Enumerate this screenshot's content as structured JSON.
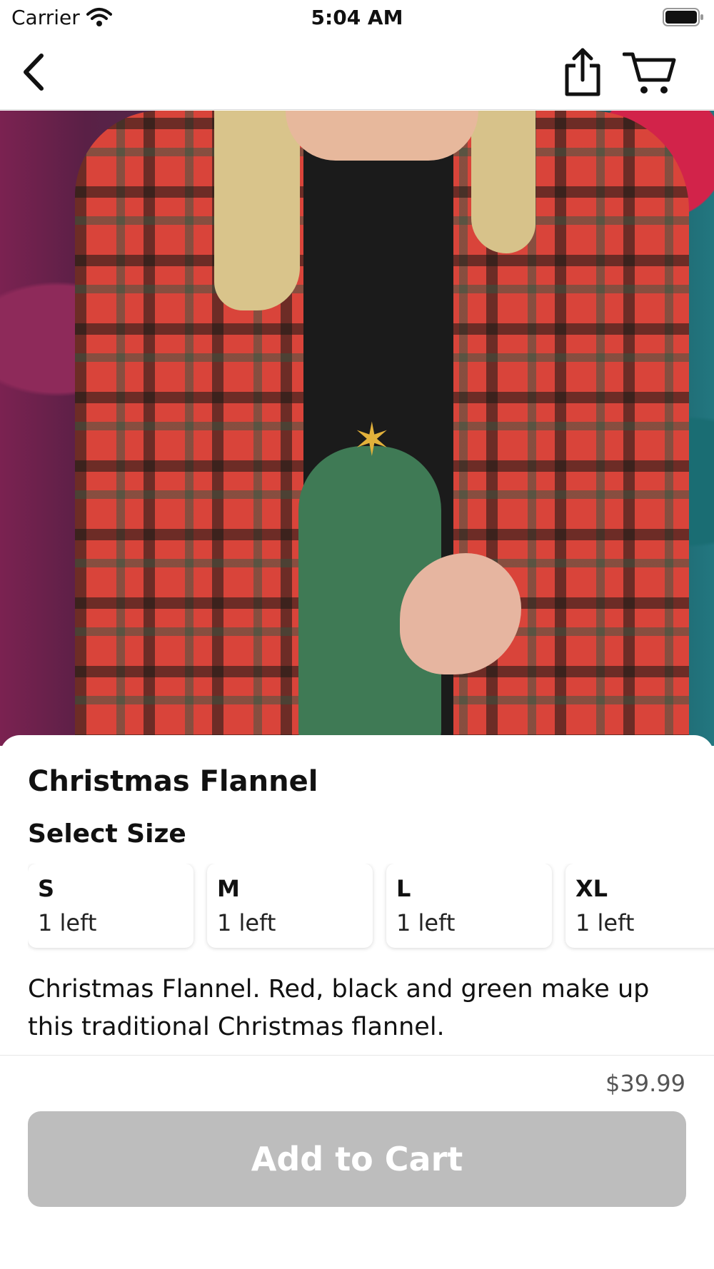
{
  "status_bar": {
    "carrier": "Carrier",
    "time": "5:04 AM",
    "icons": [
      "wifi-icon",
      "battery-icon"
    ]
  },
  "nav": {
    "icons": [
      "back-chevron-icon",
      "share-icon",
      "cart-icon"
    ]
  },
  "product": {
    "title": "Christmas Flannel",
    "select_size_label": "Select Size",
    "sizes": [
      {
        "name": "S",
        "stock": "1 left"
      },
      {
        "name": "M",
        "stock": "1 left"
      },
      {
        "name": "L",
        "stock": "1 left"
      },
      {
        "name": "XL",
        "stock": "1 left"
      }
    ],
    "description": "Christmas Flannel. Red, black and green make up this traditional Christmas flannel.",
    "price": "$39.99",
    "add_to_cart_label": "Add to Cart"
  },
  "colors": {
    "button_disabled": "#bdbdbd",
    "plaid_red": "#d9443a",
    "plaid_green": "#3f7a55"
  }
}
